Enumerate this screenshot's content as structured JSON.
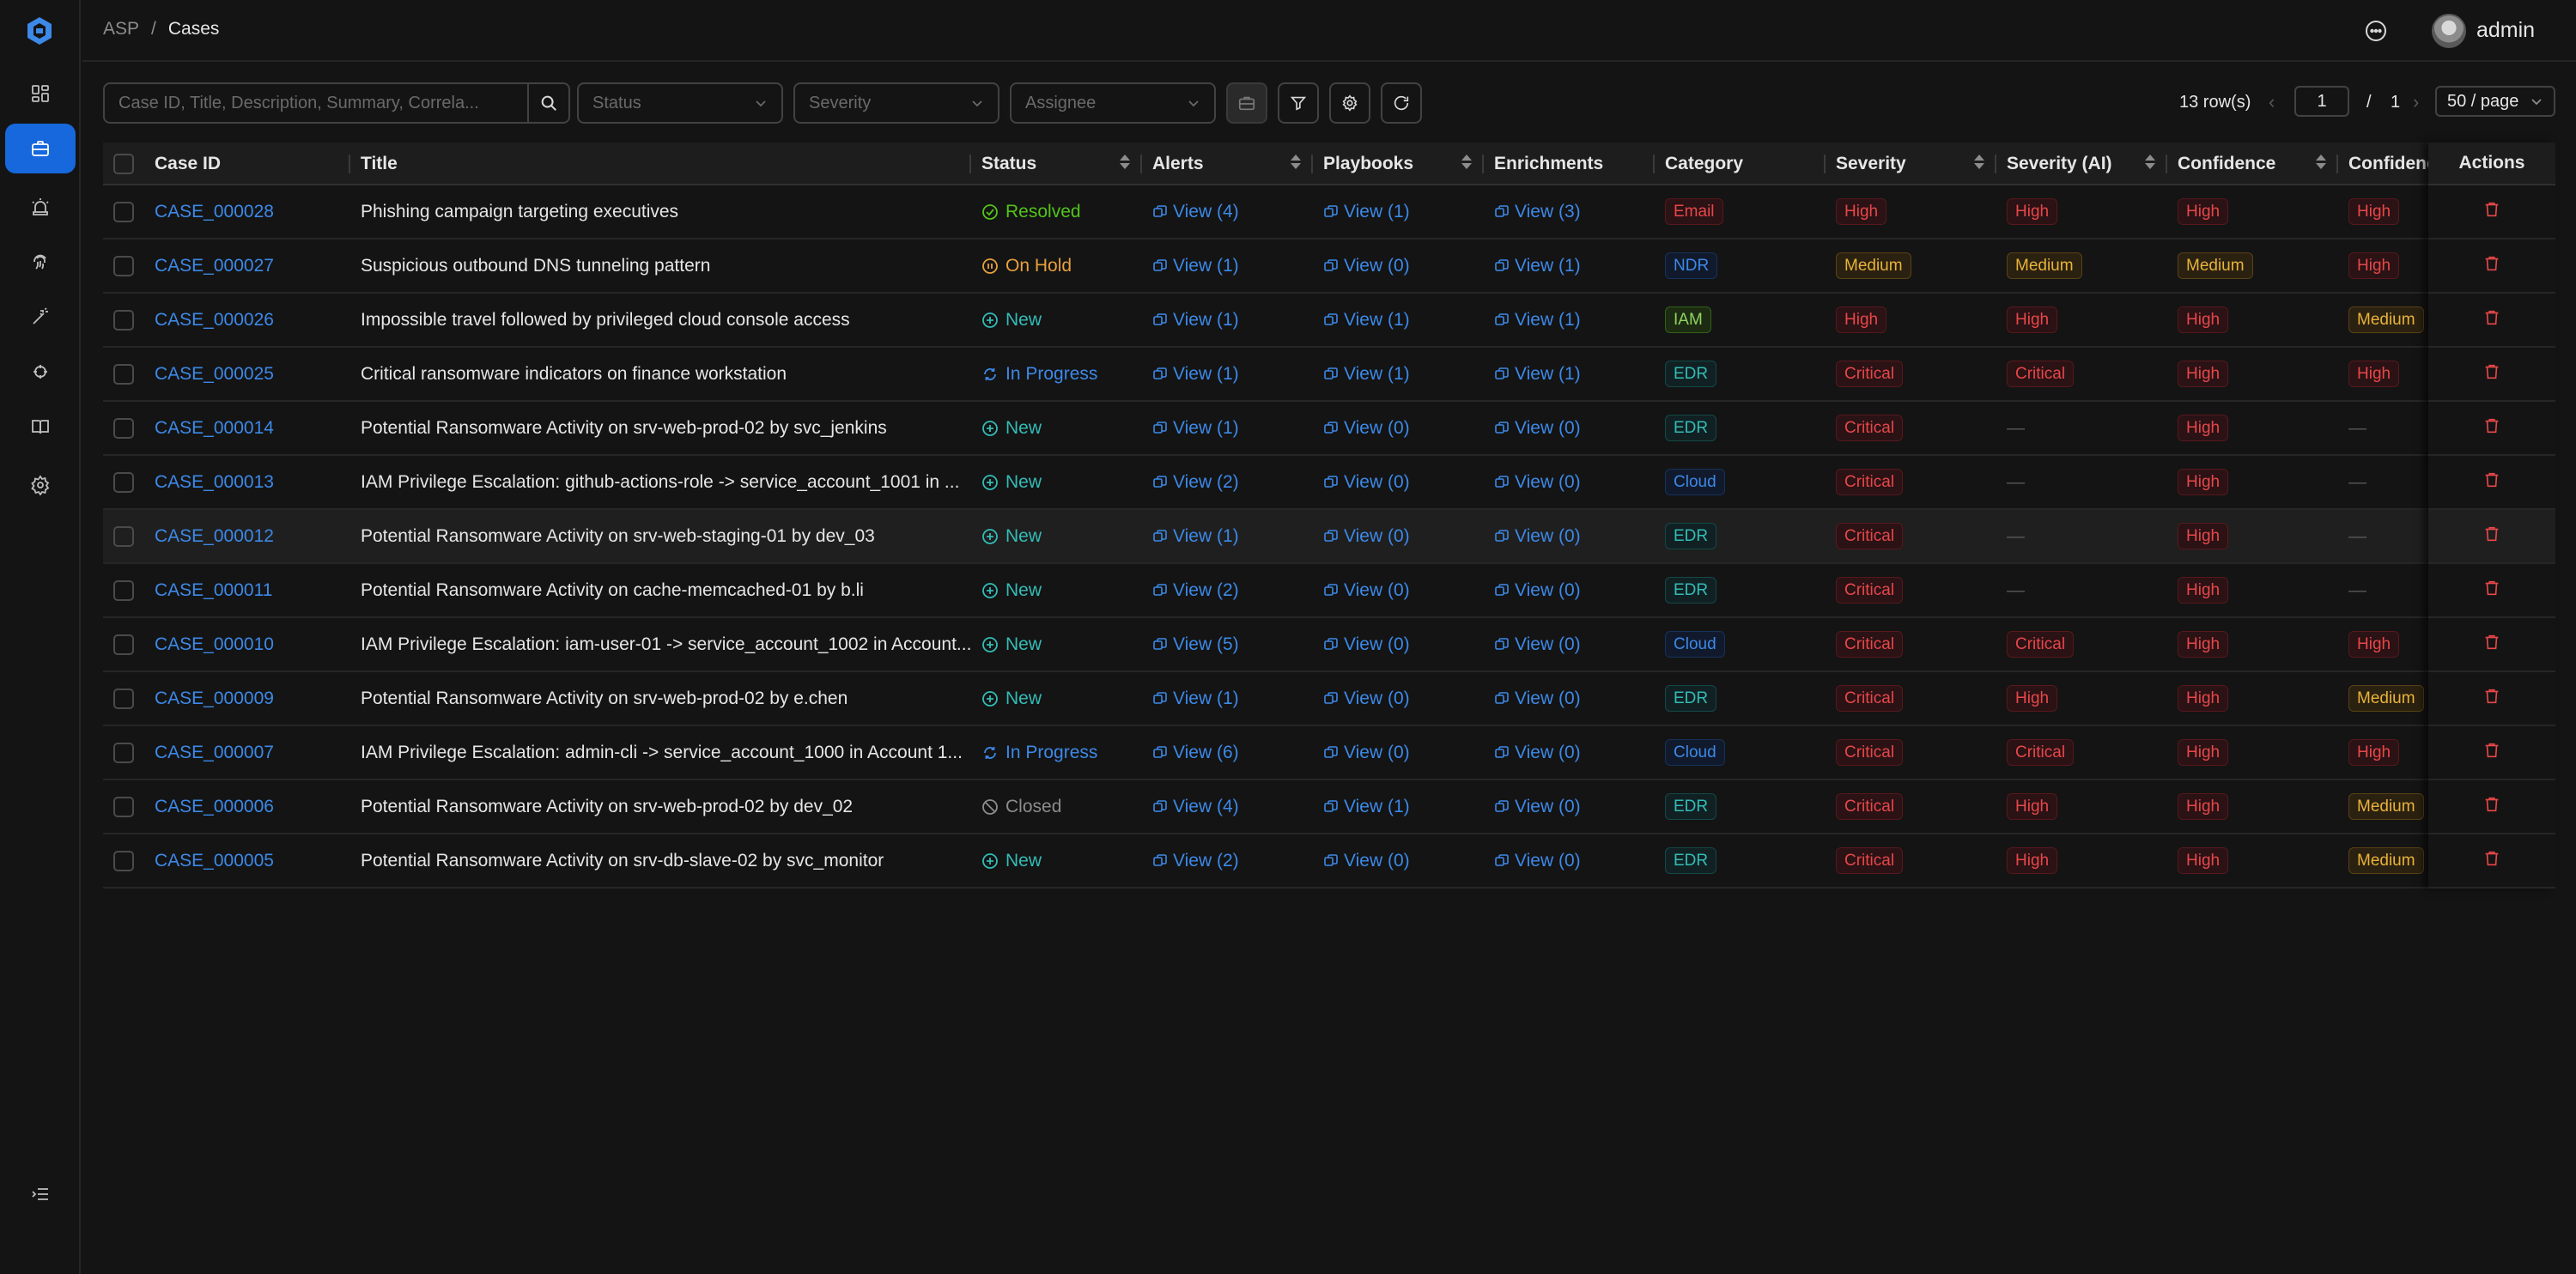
{
  "breadcrumb": {
    "root": "ASP",
    "separator": "/",
    "current": "Cases"
  },
  "user": {
    "name": "admin"
  },
  "toolbar": {
    "search_placeholder": "Case ID, Title, Description, Summary, Correla...",
    "status_placeholder": "Status",
    "severity_placeholder": "Severity",
    "assignee_placeholder": "Assignee"
  },
  "pagination": {
    "rows": "13 row(s)",
    "page": "1",
    "separator": "/",
    "total_pages": "1",
    "page_size": "50 / page"
  },
  "columns": {
    "case_id": "Case ID",
    "title": "Title",
    "status": "Status",
    "alerts": "Alerts",
    "playbooks": "Playbooks",
    "enrichments": "Enrichments",
    "category": "Category",
    "severity": "Severity",
    "severity_ai": "Severity (AI)",
    "confidence": "Confidence",
    "confidence_ai": "Confidence",
    "actions": "Actions"
  },
  "colors": {
    "accent": "#1668dc",
    "link": "#3c89e8",
    "resolved": "#52c41a",
    "on_hold": "#e8a03c",
    "new": "#33bcb7",
    "in_progress": "#3c89e8",
    "closed": "#8c8c8c",
    "delete": "#e84749"
  },
  "rows": [
    {
      "id": "CASE_000028",
      "title": "Phishing campaign targeting executives",
      "status": "Resolved",
      "status_kind": "resolved",
      "alerts": "View (4)",
      "playbooks": "View (1)",
      "enrichments": "View (3)",
      "category": "Email",
      "cat_color": "t-red",
      "severity": "High",
      "severity_color": "t-red",
      "severity_ai": "High",
      "severity_ai_color": "t-red",
      "confidence": "High",
      "confidence_color": "t-red",
      "confidence_ai": "High",
      "confidence_ai_color": "t-red"
    },
    {
      "id": "CASE_000027",
      "title": "Suspicious outbound DNS tunneling pattern",
      "status": "On Hold",
      "status_kind": "hold",
      "alerts": "View (1)",
      "playbooks": "View (0)",
      "enrichments": "View (1)",
      "category": "NDR",
      "cat_color": "t-blue",
      "severity": "Medium",
      "severity_color": "t-gold",
      "severity_ai": "Medium",
      "severity_ai_color": "t-gold",
      "confidence": "Medium",
      "confidence_color": "t-gold",
      "confidence_ai": "High",
      "confidence_ai_color": "t-red"
    },
    {
      "id": "CASE_000026",
      "title": "Impossible travel followed by privileged cloud console access",
      "status": "New",
      "status_kind": "new",
      "alerts": "View (1)",
      "playbooks": "View (1)",
      "enrichments": "View (1)",
      "category": "IAM",
      "cat_color": "t-green",
      "severity": "High",
      "severity_color": "t-red",
      "severity_ai": "High",
      "severity_ai_color": "t-red",
      "confidence": "High",
      "confidence_color": "t-red",
      "confidence_ai": "Medium",
      "confidence_ai_color": "t-gold"
    },
    {
      "id": "CASE_000025",
      "title": "Critical ransomware indicators on finance workstation",
      "status": "In Progress",
      "status_kind": "progress",
      "alerts": "View (1)",
      "playbooks": "View (1)",
      "enrichments": "View (1)",
      "category": "EDR",
      "cat_color": "t-cyan",
      "severity": "Critical",
      "severity_color": "t-red",
      "severity_ai": "Critical",
      "severity_ai_color": "t-red",
      "confidence": "High",
      "confidence_color": "t-red",
      "confidence_ai": "High",
      "confidence_ai_color": "t-red"
    },
    {
      "id": "CASE_000014",
      "title": "Potential Ransomware Activity on srv-web-prod-02 by svc_jenkins",
      "status": "New",
      "status_kind": "new",
      "alerts": "View (1)",
      "playbooks": "View (0)",
      "enrichments": "View (0)",
      "category": "EDR",
      "cat_color": "t-cyan",
      "severity": "Critical",
      "severity_color": "t-red",
      "severity_ai": "—",
      "severity_ai_color": "",
      "confidence": "High",
      "confidence_color": "t-red",
      "confidence_ai": "—",
      "confidence_ai_color": ""
    },
    {
      "id": "CASE_000013",
      "title": "IAM Privilege Escalation: github-actions-role -> service_account_1001 in ...",
      "status": "New",
      "status_kind": "new",
      "alerts": "View (2)",
      "playbooks": "View (0)",
      "enrichments": "View (0)",
      "category": "Cloud",
      "cat_color": "t-blue",
      "severity": "Critical",
      "severity_color": "t-red",
      "severity_ai": "—",
      "severity_ai_color": "",
      "confidence": "High",
      "confidence_color": "t-red",
      "confidence_ai": "—",
      "confidence_ai_color": ""
    },
    {
      "id": "CASE_000012",
      "title": "Potential Ransomware Activity on srv-web-staging-01 by dev_03",
      "status": "New",
      "status_kind": "new",
      "alerts": "View (1)",
      "playbooks": "View (0)",
      "enrichments": "View (0)",
      "category": "EDR",
      "cat_color": "t-cyan",
      "severity": "Critical",
      "severity_color": "t-red",
      "severity_ai": "—",
      "severity_ai_color": "",
      "confidence": "High",
      "confidence_color": "t-red",
      "confidence_ai": "—",
      "confidence_ai_color": ""
    },
    {
      "id": "CASE_000011",
      "title": "Potential Ransomware Activity on cache-memcached-01 by b.li",
      "status": "New",
      "status_kind": "new",
      "alerts": "View (2)",
      "playbooks": "View (0)",
      "enrichments": "View (0)",
      "category": "EDR",
      "cat_color": "t-cyan",
      "severity": "Critical",
      "severity_color": "t-red",
      "severity_ai": "—",
      "severity_ai_color": "",
      "confidence": "High",
      "confidence_color": "t-red",
      "confidence_ai": "—",
      "confidence_ai_color": ""
    },
    {
      "id": "CASE_000010",
      "title": "IAM Privilege Escalation: iam-user-01 -> service_account_1002 in Account...",
      "status": "New",
      "status_kind": "new",
      "alerts": "View (5)",
      "playbooks": "View (0)",
      "enrichments": "View (0)",
      "category": "Cloud",
      "cat_color": "t-blue",
      "severity": "Critical",
      "severity_color": "t-red",
      "severity_ai": "Critical",
      "severity_ai_color": "t-red",
      "confidence": "High",
      "confidence_color": "t-red",
      "confidence_ai": "High",
      "confidence_ai_color": "t-red"
    },
    {
      "id": "CASE_000009",
      "title": "Potential Ransomware Activity on srv-web-prod-02 by e.chen",
      "status": "New",
      "status_kind": "new",
      "alerts": "View (1)",
      "playbooks": "View (0)",
      "enrichments": "View (0)",
      "category": "EDR",
      "cat_color": "t-cyan",
      "severity": "Critical",
      "severity_color": "t-red",
      "severity_ai": "High",
      "severity_ai_color": "t-red",
      "confidence": "High",
      "confidence_color": "t-red",
      "confidence_ai": "Medium",
      "confidence_ai_color": "t-gold"
    },
    {
      "id": "CASE_000007",
      "title": "IAM Privilege Escalation: admin-cli -> service_account_1000 in Account 1...",
      "status": "In Progress",
      "status_kind": "progress",
      "alerts": "View (6)",
      "playbooks": "View (0)",
      "enrichments": "View (0)",
      "category": "Cloud",
      "cat_color": "t-blue",
      "severity": "Critical",
      "severity_color": "t-red",
      "severity_ai": "Critical",
      "severity_ai_color": "t-red",
      "confidence": "High",
      "confidence_color": "t-red",
      "confidence_ai": "High",
      "confidence_ai_color": "t-red"
    },
    {
      "id": "CASE_000006",
      "title": "Potential Ransomware Activity on srv-web-prod-02 by dev_02",
      "status": "Closed",
      "status_kind": "closed",
      "alerts": "View (4)",
      "playbooks": "View (1)",
      "enrichments": "View (0)",
      "category": "EDR",
      "cat_color": "t-cyan",
      "severity": "Critical",
      "severity_color": "t-red",
      "severity_ai": "High",
      "severity_ai_color": "t-red",
      "confidence": "High",
      "confidence_color": "t-red",
      "confidence_ai": "Medium",
      "confidence_ai_color": "t-gold"
    },
    {
      "id": "CASE_000005",
      "title": "Potential Ransomware Activity on srv-db-slave-02 by svc_monitor",
      "status": "New",
      "status_kind": "new",
      "alerts": "View (2)",
      "playbooks": "View (0)",
      "enrichments": "View (0)",
      "category": "EDR",
      "cat_color": "t-cyan",
      "severity": "Critical",
      "severity_color": "t-red",
      "severity_ai": "High",
      "severity_ai_color": "t-red",
      "confidence": "High",
      "confidence_color": "t-red",
      "confidence_ai": "Medium",
      "confidence_ai_color": "t-gold"
    }
  ]
}
